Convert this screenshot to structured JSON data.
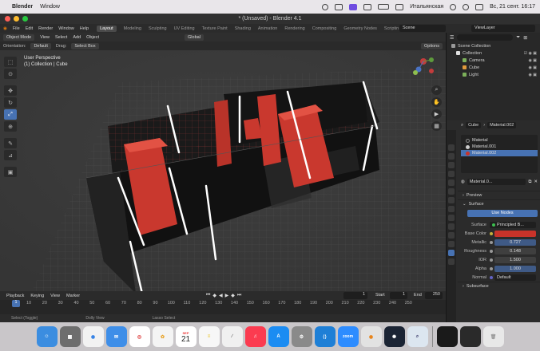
{
  "macbar": {
    "app": "Blender",
    "menus": [
      "Window"
    ],
    "input_source": "Итальянская",
    "clock": "Вс, 21 сент.  16:17"
  },
  "window": {
    "title": "* (Unsaved) - Blender 4.1"
  },
  "topbar": {
    "menus": [
      "File",
      "Edit",
      "Render",
      "Window",
      "Help"
    ],
    "workspaces": [
      "Layout",
      "Modeling",
      "Sculpting",
      "UV Editing",
      "Texture Paint",
      "Shading",
      "Animation",
      "Rendering",
      "Compositing",
      "Geometry Nodes",
      "Scriptin"
    ],
    "active_workspace": "Layout",
    "scene": "Scene",
    "view_layer": "ViewLayer"
  },
  "viewport_header": {
    "mode": "Object Mode",
    "menus": [
      "View",
      "Select",
      "Add",
      "Object"
    ],
    "transform": "Global"
  },
  "options_bar": {
    "orientation_label": "Orientation:",
    "orientation": "Default",
    "drag_label": "Drag:",
    "drag": "Select Box",
    "options": "Options"
  },
  "viewport": {
    "perspective": "User Perspective",
    "collection": "(1) Collection | Cube"
  },
  "timeline": {
    "menus": [
      "Playback",
      "Keying",
      "View",
      "Marker"
    ],
    "current_frame": "1",
    "start_label": "Start",
    "start": "1",
    "end_label": "End",
    "end": "250",
    "ruler_current": "1",
    "ticks": [
      "10",
      "20",
      "30",
      "40",
      "50",
      "60",
      "70",
      "80",
      "90",
      "100",
      "110",
      "120",
      "130",
      "140",
      "150",
      "160",
      "170",
      "180",
      "190",
      "200",
      "210",
      "220",
      "230",
      "240",
      "250"
    ]
  },
  "status": {
    "left": "Select (Toggle)",
    "mid": "Dolly View",
    "right": "Lasso Select"
  },
  "outliner": {
    "rows": [
      {
        "label": "Scene Collection",
        "color": "#9a9a9a"
      },
      {
        "label": "Collection",
        "color": "#e0e0e0"
      },
      {
        "label": "Camera",
        "color": "#7cb05a"
      },
      {
        "label": "Cube",
        "color": "#e09a3c"
      },
      {
        "label": "Light",
        "color": "#7cb05a"
      }
    ]
  },
  "properties": {
    "object": "Cube",
    "material_breadcrumb": "Material.002",
    "slots": [
      "Material",
      "Material.001",
      "Material.002"
    ],
    "selected_slot": "Material.002",
    "material_name": "Material.0...",
    "preview": "Preview",
    "surface": "Surface",
    "use_nodes": "Use Nodes",
    "surface_label": "Surface",
    "surface_value": "Principled B...",
    "base_color_label": "Base Color",
    "metallic_label": "Metallic",
    "metallic": "0.727",
    "roughness_label": "Roughness",
    "roughness": "0.148",
    "ior_label": "IOR",
    "ior": "1.500",
    "alpha_label": "Alpha",
    "alpha": "1.000",
    "normal_label": "Normal",
    "normal": "Default",
    "subsurface": "Subsurface"
  },
  "dock": {
    "calendar_month": "SEP",
    "calendar_day": "21",
    "zoom_label": "zoom"
  }
}
